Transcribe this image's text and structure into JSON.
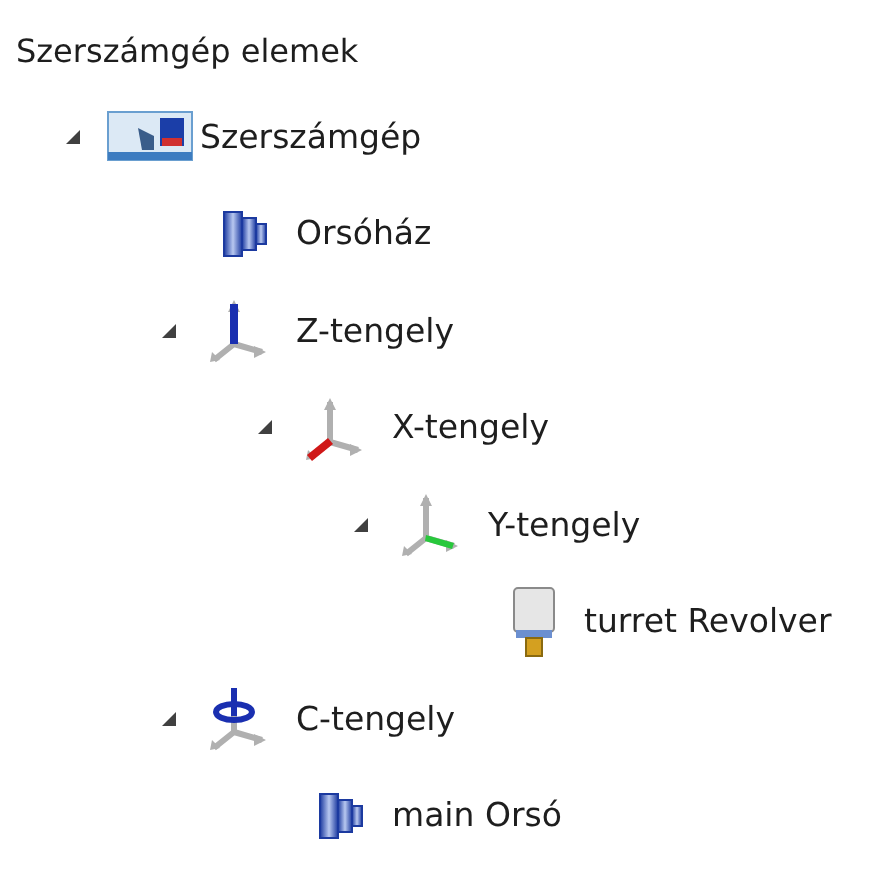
{
  "panel": {
    "title": "Szerszámgép elemek"
  },
  "tree": [
    {
      "label": "Szerszámgép",
      "kind": "machine",
      "expanded": true,
      "children": [
        {
          "label": "Orsóház",
          "kind": "spindle"
        },
        {
          "label": "Z-tengely",
          "kind": "axis",
          "color": "#1a2fb0",
          "expanded": true,
          "children": [
            {
              "label": "X-tengely",
              "kind": "axis",
              "color": "#d01818",
              "expanded": true,
              "children": [
                {
                  "label": "Y-tengely",
                  "kind": "axis",
                  "color": "#28c83c",
                  "expanded": true,
                  "children": [
                    {
                      "label": "turret Revolver",
                      "kind": "tool"
                    }
                  ]
                }
              ]
            }
          ]
        },
        {
          "label": "C-tengely",
          "kind": "rotary",
          "expanded": true,
          "children": [
            {
              "label": "main Orsó",
              "kind": "spindle"
            }
          ]
        }
      ]
    }
  ]
}
